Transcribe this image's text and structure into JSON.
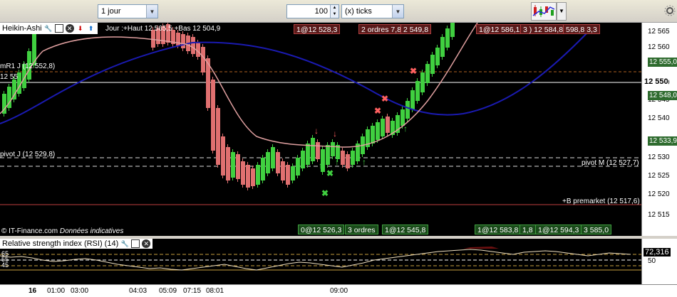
{
  "toolbar": {
    "period": "1 jour",
    "tick_count": "100",
    "tick_unit": "(x) ticks"
  },
  "main": {
    "indicator": "Heikin-Ashi",
    "ohlc_info": "Jour :+Haut 12 565,5 +Bas 12 504,9",
    "labels": {
      "mr1": "mR1 J (12 552,8)",
      "left_555": "12 55",
      "pivot_j": "pivot J (12 529,8)",
      "pivot_m": "pivot M (12 527,7)",
      "premarket": "+B premarket (12 517,6)",
      "source": "© IT-Finance.com",
      "disclaimer": "Données indicatives"
    },
    "orders_top": [
      {
        "text": "1@12 528,3",
        "color": "red"
      },
      {
        "text": "2 ordres 7,8",
        "color": "red"
      },
      {
        "text": "2 549,8",
        "color": "red"
      },
      {
        "text": "1@12 586,1",
        "color": "red"
      },
      {
        "text": "3 ) 12 584,8",
        "color": "red"
      },
      {
        "text": "598,8 3,3",
        "color": "red"
      }
    ],
    "orders_bottom": [
      {
        "text": "0@12 526,3",
        "color": "green"
      },
      {
        "text": "3 ordres",
        "color": "green"
      },
      {
        "text": "1@12 545,8",
        "color": "green"
      },
      {
        "text": "1@12 583,8",
        "color": "green"
      },
      {
        "text": "1,8",
        "color": "green"
      },
      {
        "text": "1@12 594,3",
        "color": "green"
      },
      {
        "text": "3 585,0",
        "color": "green"
      }
    ]
  },
  "price_axis": {
    "ticks": [
      "12 565",
      "12 560",
      "12 555",
      "12 550",
      "12 545",
      "12 540",
      "12 535",
      "12 530",
      "12 525",
      "12 520",
      "12 515"
    ],
    "current": "12 550",
    "tags": [
      {
        "text": "12 555,0",
        "color": "#2e6b2e"
      },
      {
        "text": "12 548,0",
        "color": "#2e6b2e"
      },
      {
        "text": "12 533,9",
        "color": "#2e6b2e"
      }
    ]
  },
  "rsi": {
    "title": "Relative strength index (RSI) (14)",
    "value": "72,316",
    "tick": "50",
    "left_labels": [
      "65",
      "55",
      "45"
    ]
  },
  "time_axis": {
    "labels": [
      "16",
      "01:00",
      "03:00",
      "04:03",
      "05:09",
      "07:15",
      "08:01",
      "09:00"
    ]
  }
}
